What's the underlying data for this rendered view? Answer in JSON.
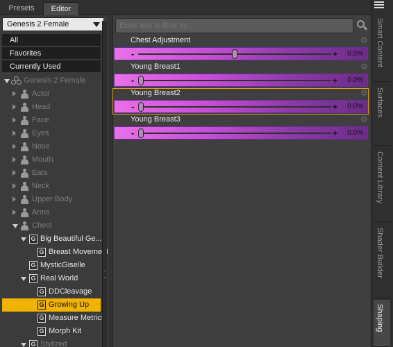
{
  "tabs": {
    "presets": "Presets",
    "editor": "Editor"
  },
  "left": {
    "figure_select": "Genesis 2 Female",
    "items": [
      "All",
      "Favorites",
      "Currently Used"
    ],
    "tree": [
      {
        "label": "Genesis 2 Female",
        "kind": "figure",
        "depth": 0,
        "state": "down",
        "dim": true
      },
      {
        "label": "Actor",
        "kind": "person",
        "depth": 1,
        "state": "right",
        "dim": true
      },
      {
        "label": "Head",
        "kind": "person",
        "depth": 1,
        "state": "right",
        "dim": true
      },
      {
        "label": "Face",
        "kind": "person",
        "depth": 1,
        "state": "right",
        "dim": true
      },
      {
        "label": "Eyes",
        "kind": "person",
        "depth": 1,
        "state": "right",
        "dim": true
      },
      {
        "label": "Nose",
        "kind": "person",
        "depth": 1,
        "state": "right",
        "dim": true
      },
      {
        "label": "Mouth",
        "kind": "person",
        "depth": 1,
        "state": "right",
        "dim": true
      },
      {
        "label": "Ears",
        "kind": "person",
        "depth": 1,
        "state": "right",
        "dim": true
      },
      {
        "label": "Neck",
        "kind": "person",
        "depth": 1,
        "state": "right",
        "dim": true
      },
      {
        "label": "Upper Body",
        "kind": "person",
        "depth": 1,
        "state": "right",
        "dim": true
      },
      {
        "label": "Arms",
        "kind": "person",
        "depth": 1,
        "state": "right",
        "dim": true
      },
      {
        "label": "Chest",
        "kind": "person",
        "depth": 1,
        "state": "down",
        "dim": true
      },
      {
        "label": "Big Beautiful Ge...",
        "kind": "group",
        "depth": 2,
        "state": "down",
        "dim": false
      },
      {
        "label": "Breast Movement",
        "kind": "group",
        "depth": 3,
        "state": "none",
        "dim": false
      },
      {
        "label": "MysticGiselle",
        "kind": "group",
        "depth": 2,
        "state": "none",
        "dim": false
      },
      {
        "label": "Real World",
        "kind": "group",
        "depth": 2,
        "state": "down",
        "dim": false
      },
      {
        "label": "DDCleavage",
        "kind": "group",
        "depth": 3,
        "state": "none",
        "dim": false
      },
      {
        "label": "Growing Up",
        "kind": "group",
        "depth": 3,
        "state": "none",
        "dim": false,
        "selected": true
      },
      {
        "label": "Measure Metrics",
        "kind": "group",
        "depth": 3,
        "state": "none",
        "dim": false
      },
      {
        "label": "Morph Kit",
        "kind": "group",
        "depth": 3,
        "state": "none",
        "dim": false
      },
      {
        "label": "Stylized",
        "kind": "group",
        "depth": 2,
        "state": "down",
        "dim": true
      }
    ]
  },
  "filter": {
    "placeholder": "Enter text to filter by..."
  },
  "properties": [
    {
      "name": "Chest Adjustment",
      "minus": "-",
      "plus": "+",
      "value": "0.0%",
      "position": 0.5,
      "highlighted": false
    },
    {
      "name": "Young Breast1",
      "minus": "-",
      "plus": "+",
      "value": "0.0%",
      "position": 0.0,
      "highlighted": false
    },
    {
      "name": "Young Breast2",
      "minus": "-",
      "plus": "+",
      "value": "0.0%",
      "position": 0.0,
      "highlighted": true
    },
    {
      "name": "Young Breast3",
      "minus": "-",
      "plus": "+",
      "value": "0.0%",
      "position": 0.0,
      "highlighted": false
    }
  ],
  "side_tabs": [
    "Smart Content",
    "Surfaces",
    "Content Library",
    "Shader Builder",
    "Shaping"
  ],
  "active_side_tab": "Shaping",
  "colors": {
    "selection": "#f0b400",
    "slider_fill": "#e870e8",
    "highlight_frame": "#d8a020"
  }
}
